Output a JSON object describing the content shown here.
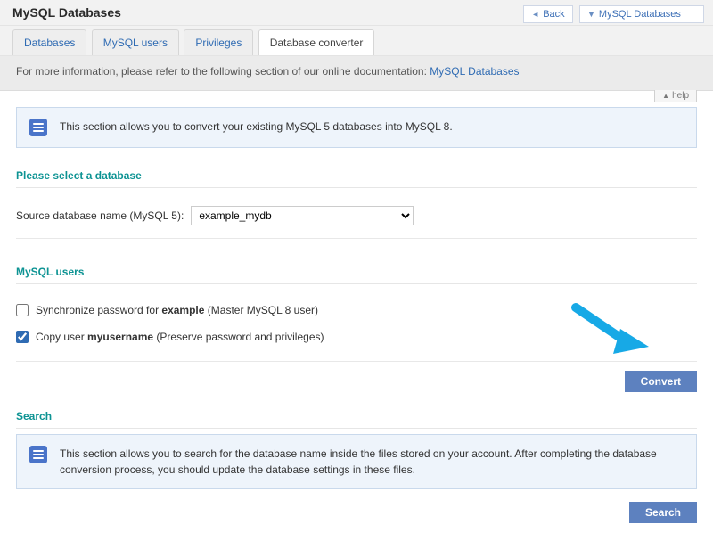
{
  "header": {
    "title": "MySQL Databases",
    "back_label": "Back",
    "breadcrumb": "MySQL Databases"
  },
  "tabs": [
    {
      "label": "Databases"
    },
    {
      "label": "MySQL users"
    },
    {
      "label": "Privileges"
    },
    {
      "label": "Database converter"
    }
  ],
  "doc_strip": {
    "text": "For more information, please refer to the following section of our online documentation: ",
    "link": "MySQL Databases"
  },
  "help_label": "help",
  "info1": "This section allows you to convert your existing MySQL 5 databases into MySQL 8.",
  "select_db": {
    "heading": "Please select a database",
    "label": "Source database name (MySQL 5):",
    "value": "example_mydb"
  },
  "users": {
    "heading": "MySQL users",
    "row1_pre": "Synchronize password for ",
    "row1_bold": "example",
    "row1_post": " (Master MySQL 8 user)",
    "row1_checked": false,
    "row2_pre": "Copy user ",
    "row2_bold": "myusername",
    "row2_post": " (Preserve password and privileges)",
    "row2_checked": true
  },
  "convert_label": "Convert",
  "search": {
    "heading": "Search",
    "info": "This section allows you to search for the database name inside the files stored on your account. After completing the database conversion process, you should update the database settings in these files.",
    "button": "Search"
  }
}
